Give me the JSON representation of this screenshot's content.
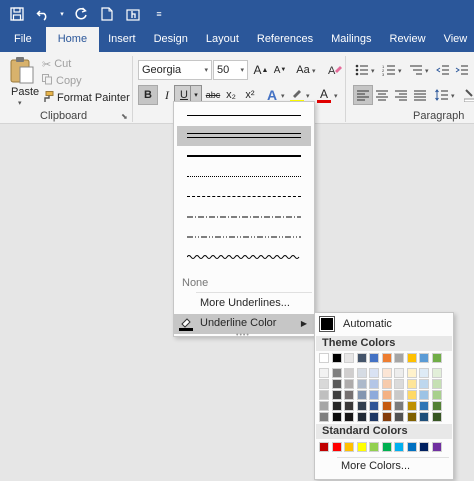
{
  "tabs": [
    "File",
    "Home",
    "Insert",
    "Design",
    "Layout",
    "References",
    "Mailings",
    "Review",
    "View"
  ],
  "clipboard": {
    "paste": "Paste",
    "cut": "Cut",
    "copy": "Copy",
    "format_painter": "Format Painter",
    "group_label": "Clipboard"
  },
  "font": {
    "name": "Georgia",
    "size": "50",
    "bold": "B",
    "italic": "I",
    "underline": "U",
    "strike": "abc",
    "subscript": "x₂",
    "superscript": "x²",
    "text_effects": "A",
    "font_color": "A"
  },
  "paragraph": {
    "group_label": "Paragraph"
  },
  "underline_menu": {
    "none_label": "None",
    "more_label": "More Underlines...",
    "color_label": "Underline Color"
  },
  "color_menu": {
    "automatic": "Automatic",
    "theme_header": "Theme Colors",
    "standard_header": "Standard Colors",
    "more_colors": "More Colors...",
    "theme_colors": [
      [
        "#ffffff",
        "#000000",
        "#e7e6e6",
        "#44546a",
        "#4472c4",
        "#ed7d31",
        "#a5a5a5",
        "#ffc000",
        "#5b9bd5",
        "#70ad47"
      ],
      [
        "#f2f2f2",
        "#7f7f7f",
        "#d0cece",
        "#d6dce4",
        "#d9e2f3",
        "#fbe5d5",
        "#ededed",
        "#fff2cc",
        "#deebf6",
        "#e2efd9"
      ],
      [
        "#d8d8d8",
        "#595959",
        "#aeabab",
        "#adb9ca",
        "#b4c6e7",
        "#f7cbac",
        "#dbdbdb",
        "#fee599",
        "#bdd7ee",
        "#c5e0b3"
      ],
      [
        "#bfbfbf",
        "#3f3f3f",
        "#757070",
        "#8496b0",
        "#8eaadb",
        "#f4b183",
        "#c9c9c9",
        "#ffd965",
        "#9cc3e5",
        "#a8d08d"
      ],
      [
        "#a5a5a5",
        "#262626",
        "#3a3838",
        "#323f4f",
        "#2f5496",
        "#c55a11",
        "#7b7b7b",
        "#bf9000",
        "#2e75b5",
        "#538135"
      ],
      [
        "#7f7f7f",
        "#0c0c0c",
        "#171616",
        "#222a35",
        "#1f3864",
        "#833c0b",
        "#525252",
        "#7f6000",
        "#1e4e79",
        "#375623"
      ]
    ],
    "standard_colors": [
      "#c00000",
      "#ff0000",
      "#ffc000",
      "#ffff00",
      "#92d050",
      "#00b050",
      "#00b0f0",
      "#0070c0",
      "#002060",
      "#7030a0"
    ]
  }
}
